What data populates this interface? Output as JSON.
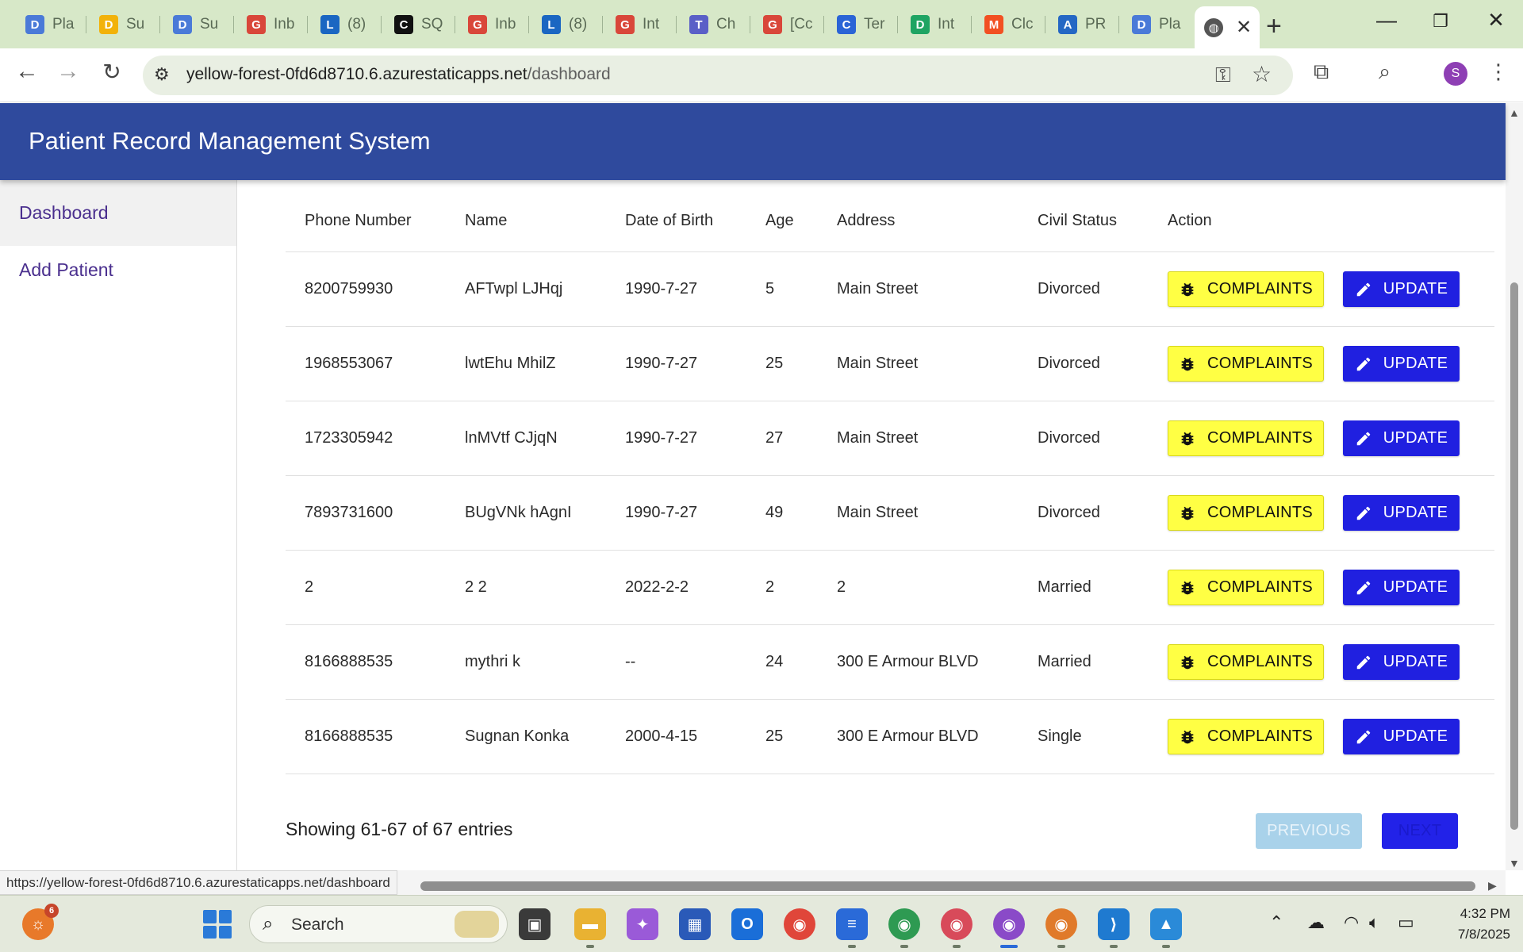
{
  "browser": {
    "tabs": [
      {
        "title": "Pla",
        "icon": "docs-icon",
        "color": "#4a7ad8"
      },
      {
        "title": "Su",
        "icon": "drive-icon",
        "color": "#f2b20a"
      },
      {
        "title": "Su",
        "icon": "docs-icon",
        "color": "#4a7ad8"
      },
      {
        "title": "Inb",
        "icon": "gmail-icon",
        "color": "#d9473a"
      },
      {
        "title": "(8)",
        "icon": "linkedin-icon",
        "color": "#1a66c2"
      },
      {
        "title": "SQ",
        "icon": "chatgpt-icon",
        "color": "#111111"
      },
      {
        "title": "Inb",
        "icon": "gmail-icon",
        "color": "#d9473a"
      },
      {
        "title": "(8)",
        "icon": "linkedin-icon",
        "color": "#1a66c2"
      },
      {
        "title": "Int",
        "icon": "gmail-icon",
        "color": "#d9473a"
      },
      {
        "title": "Ch",
        "icon": "teams-icon",
        "color": "#5a5fc7"
      },
      {
        "title": "[Cc",
        "icon": "gmail-icon",
        "color": "#d9473a"
      },
      {
        "title": "Ter",
        "icon": "confluence-icon",
        "color": "#2a64d6"
      },
      {
        "title": "Int",
        "icon": "drive-icon",
        "color": "#1fa463"
      },
      {
        "title": "Clc",
        "icon": "microsoft-icon",
        "color": "#f25022"
      },
      {
        "title": "PR",
        "icon": "azure-icon",
        "color": "#2467c4"
      },
      {
        "title": "Pla",
        "icon": "docs-icon",
        "color": "#4a7ad8"
      }
    ],
    "url_host": "yellow-forest-0fd6d8710.6.azurestaticapps.net",
    "url_path": "/dashboard",
    "profile_initial": "S",
    "status_url": "https://yellow-forest-0fd6d8710.6.azurestaticapps.net/dashboard"
  },
  "app": {
    "title": "Patient Record Management System",
    "header_color": "#2f4a9d"
  },
  "sidebar": {
    "items": [
      {
        "label": "Dashboard",
        "active": true
      },
      {
        "label": "Add Patient",
        "active": false
      }
    ]
  },
  "table": {
    "columns": [
      "Phone Number",
      "Name",
      "Date of Birth",
      "Age",
      "Address",
      "Civil Status",
      "Action"
    ],
    "rows": [
      {
        "phone": "8200759930",
        "name": "AFTwpl LJHqj",
        "dob": "1990-7-27",
        "age": "5",
        "address": "Main Street",
        "status": "Divorced"
      },
      {
        "phone": "1968553067",
        "name": "lwtEhu MhilZ",
        "dob": "1990-7-27",
        "age": "25",
        "address": "Main Street",
        "status": "Divorced"
      },
      {
        "phone": "1723305942",
        "name": "lnMVtf CJjqN",
        "dob": "1990-7-27",
        "age": "27",
        "address": "Main Street",
        "status": "Divorced"
      },
      {
        "phone": "7893731600",
        "name": "BUgVNk hAgnI",
        "dob": "1990-7-27",
        "age": "49",
        "address": "Main Street",
        "status": "Divorced"
      },
      {
        "phone": "2",
        "name": "2 2",
        "dob": "2022-2-2",
        "age": "2",
        "address": "2",
        "status": "Married"
      },
      {
        "phone": "8166888535",
        "name": "mythri k",
        "dob": "--",
        "age": "24",
        "address": "300 E Armour BLVD",
        "status": "Married"
      },
      {
        "phone": "8166888535",
        "name": "Sugnan Konka",
        "dob": "2000-4-15",
        "age": "25",
        "address": "300 E Armour BLVD",
        "status": "Single"
      }
    ],
    "complaints_label": "COMPLAINTS",
    "update_label": "UPDATE",
    "complaints_color": "#ffff44",
    "update_color": "#2020e0"
  },
  "pagination": {
    "summary": "Showing 61-67 of 67 entries",
    "prev_label": "PREVIOUS",
    "next_label": "NEXT"
  },
  "taskbar": {
    "search_label": "Search",
    "clock_time": "4:32 PM",
    "clock_date": "7/8/2025",
    "weather_badge": "6"
  }
}
